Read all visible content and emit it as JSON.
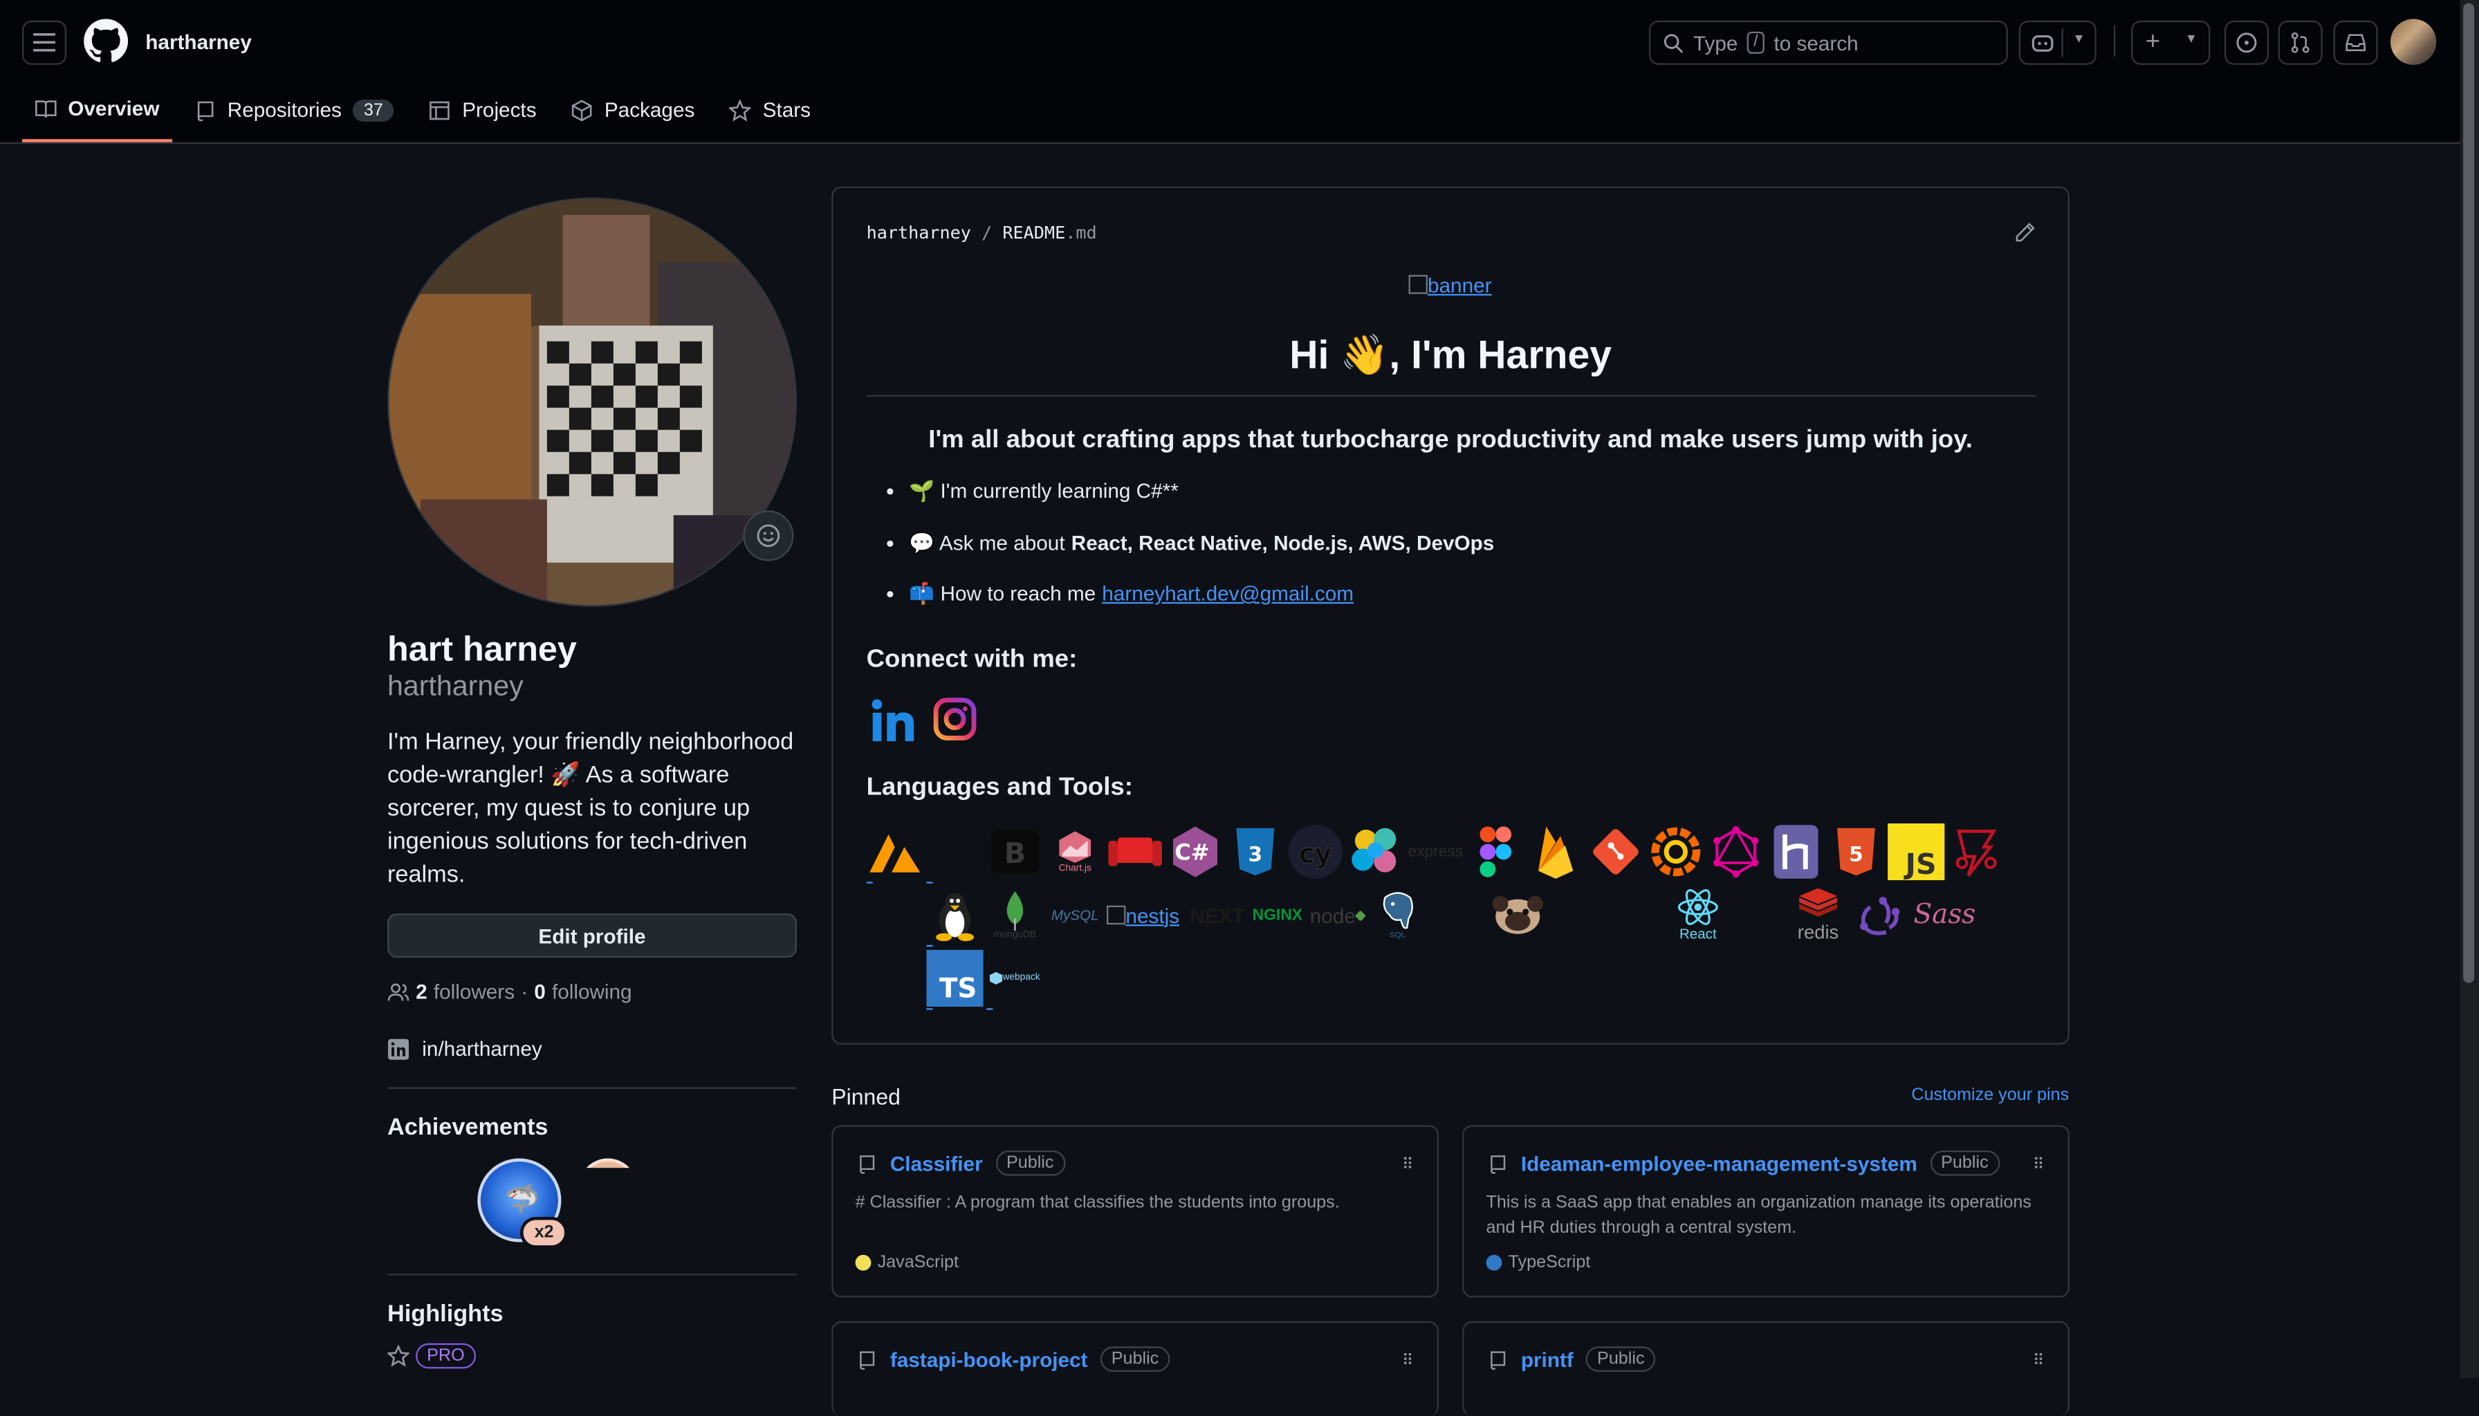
{
  "header": {
    "username": "hartharney",
    "search_placeholder_prefix": "Type",
    "search_key": "/",
    "search_placeholder_suffix": "to search"
  },
  "tabs": [
    {
      "label": "Overview",
      "active": true
    },
    {
      "label": "Repositories",
      "count": "37"
    },
    {
      "label": "Projects"
    },
    {
      "label": "Packages"
    },
    {
      "label": "Stars"
    }
  ],
  "profile": {
    "name": "hart harney",
    "login": "hartharney",
    "bio": "I'm Harney, your friendly neighborhood code-wrangler! 🚀 As a software sorcerer, my quest is to conjure up ingenious solutions for tech-driven realms.",
    "edit_label": "Edit profile",
    "followers": "2",
    "followers_label": "followers",
    "following": "0",
    "following_label": "following",
    "linkedin": "in/hartharney",
    "achievements_title": "Achievements",
    "achievement_badge": "x2",
    "highlights_title": "Highlights",
    "pro_badge": "PRO"
  },
  "readme": {
    "owner": "hartharney",
    "file": "README",
    "ext": ".md",
    "banner_alt": "banner",
    "greeting": "Hi 👋, I'm Harney",
    "tagline": "I'm all about crafting apps that turbocharge productivity and make users jump with joy.",
    "b1": "🌱 I'm currently learning C#**",
    "b2_prefix": "💬 Ask me about ",
    "b2_bold": "React, React Native, Node.js, AWS, DevOps",
    "b3_prefix": "📫 How to reach me ",
    "email": "harneyhart.dev@gmail.com",
    "connect_title": "Connect with me:",
    "tools_title": "Languages and Tools:",
    "tool_labels": {
      "chartjs": "Chart.js",
      "mongodb": "mongoDB",
      "mysql": "MySQL",
      "nestjs": "nestjs",
      "next": "NEXT",
      "nginx": "NGINX",
      "node": "node",
      "sql": "SQL",
      "react": "React",
      "redis": "redis",
      "sass": "Sass",
      "ts": "TS",
      "webpack": "webpack",
      "js": "JS",
      "ch": "C#"
    }
  },
  "pinned": {
    "title": "Pinned",
    "customize": "Customize your pins",
    "repos": [
      {
        "name": "Classifier",
        "visibility": "Public",
        "desc": "# Classifier : A program that classifies the students into groups.",
        "lang": "JavaScript",
        "lang_color": "#f1e05a"
      },
      {
        "name": "Ideaman-employee-management-system",
        "visibility": "Public",
        "desc": "This is a SaaS app that enables an organization manage its operations and HR duties through a central system.",
        "lang": "TypeScript",
        "lang_color": "#3178c6"
      },
      {
        "name": "fastapi-book-project",
        "visibility": "Public"
      },
      {
        "name": "printf",
        "visibility": "Public"
      }
    ]
  }
}
